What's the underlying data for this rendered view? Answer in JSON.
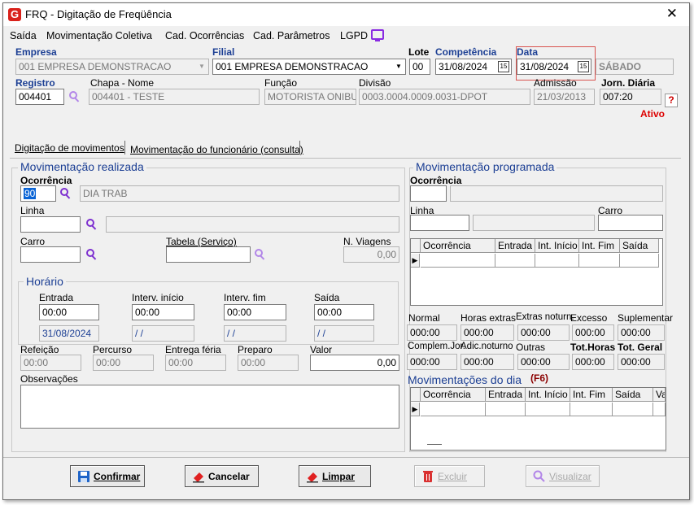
{
  "window": {
    "title": "FRQ - Digitação de Freqüência",
    "icon_letter": "G",
    "close": "✕"
  },
  "menu": [
    "Saída",
    "Movimentação Coletiva",
    "Cad. Ocorrências",
    "Cad. Parâmetros",
    "LGPD"
  ],
  "header": {
    "empresa_label": "Empresa",
    "empresa_value": "001 EMPRESA DEMONSTRACAO",
    "filial_label": "Filial",
    "filial_value": "001 EMPRESA DEMONSTRACAO",
    "lote_label": "Lote",
    "lote_value": "00",
    "competencia_label": "Competência",
    "competencia_value": "31/08/2024",
    "data_label": "Data",
    "data_value": "31/08/2024",
    "weekday": "SÁBADO",
    "registro_label": "Registro",
    "registro_value": "004401",
    "chapa_nome_label": "Chapa - Nome",
    "chapa_nome_value": "004401 - TESTE",
    "funcao_label": "Função",
    "funcao_value": "MOTORISTA ONIBU",
    "divisao_label": "Divisão",
    "divisao_value": "0003.0004.0009.0031-DPOT",
    "admissao_label": "Admissão",
    "admissao_value": "21/03/2013",
    "jornada_label": "Jorn. Diária",
    "jornada_value": "007:20",
    "help": "?",
    "status": "Ativo"
  },
  "tabs": [
    "Digitação de movimentos",
    "Movimentação do funcionário (consulta)"
  ],
  "realizada": {
    "title": "Movimentação realizada",
    "ocorrencia_label": "Ocorrência",
    "ocorrencia_code": "90",
    "ocorrencia_desc": "DIA TRAB",
    "linha_label": "Linha",
    "carro_label": "Carro",
    "tabela_label": "Tabela (Serviço)",
    "nviagens_label": "N. Viagens",
    "nviagens_value": "0,00",
    "horario_title": "Horário",
    "entrada_label": "Entrada",
    "entrada_value": "00:00",
    "entrada_date": "31/08/2024",
    "iinicio_label": "Interv. início",
    "iinicio_value": "00:00",
    "iinicio_date": "/ /",
    "ifim_label": "Interv. fim",
    "ifim_value": "00:00",
    "ifim_date": "/ /",
    "saida_label": "Saída",
    "saida_value": "00:00",
    "saida_date": "/ /",
    "refeicao_label": "Refeição",
    "refeicao_value": "00:00",
    "percurso_label": "Percurso",
    "percurso_value": "00:00",
    "entrega_label": "Entrega féria",
    "entrega_value": "00:00",
    "preparo_label": "Preparo",
    "preparo_value": "00:00",
    "valor_label": "Valor",
    "valor_value": "0,00",
    "obs_label": "Observações"
  },
  "programada": {
    "title": "Movimentação programada",
    "ocorrencia_label": "Ocorrência",
    "linha_label": "Linha",
    "carro_label": "Carro",
    "grid_headers": [
      "Ocorrência",
      "Entrada",
      "Int. Início",
      "Int. Fim",
      "Saída"
    ],
    "totals_row1": [
      {
        "label": "Normal",
        "value": "000:00"
      },
      {
        "label": "Horas extras",
        "value": "000:00"
      },
      {
        "label": "Extras noturn.",
        "value": "000:00"
      },
      {
        "label": "Excesso",
        "value": "000:00"
      },
      {
        "label": "Suplementar",
        "value": "000:00"
      }
    ],
    "totals_row2": [
      {
        "label": "Complem.Jor.",
        "value": "000:00"
      },
      {
        "label": "Adic.noturno",
        "value": "000:00"
      },
      {
        "label": "Outras",
        "value": "000:00"
      },
      {
        "label": "Tot.Horas",
        "value": "000:00"
      },
      {
        "label": "Tot. Geral",
        "value": "000:00"
      }
    ]
  },
  "dia": {
    "title": "Movimentações do dia",
    "shortcut": "(F6)",
    "grid_headers": [
      "Ocorrência",
      "Entrada",
      "Int. Início",
      "Int. Fim",
      "Saída",
      "Va"
    ]
  },
  "buttons": {
    "confirmar": "Confirmar",
    "cancelar": "Cancelar",
    "limpar": "Limpar",
    "excluir": "Excluir",
    "visualizar": "Visualizar"
  },
  "colors": {
    "accent_blue": "#1c3f94",
    "icon_purple": "#7d2fd0",
    "status_red": "#dd0000"
  }
}
